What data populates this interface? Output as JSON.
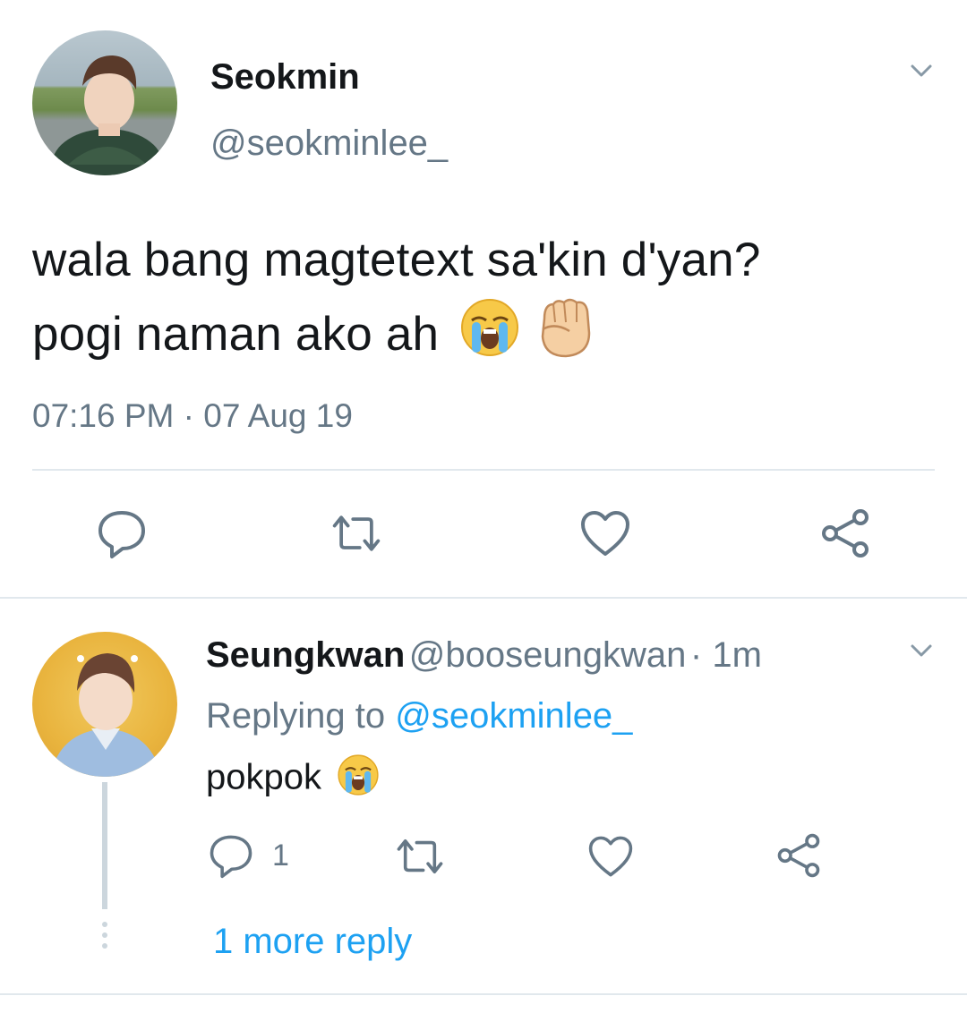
{
  "tweet": {
    "display_name": "Seokmin",
    "handle": "@seokminlee_",
    "text_line1": "wala bang magtetext sa'kin d'yan?",
    "text_line2": "pogi naman ako ah",
    "timestamp": "07:16 PM · 07 Aug 19",
    "emojis": [
      "loudly-crying-face",
      "raised-fist"
    ]
  },
  "reply": {
    "display_name": "Seungkwan",
    "handle": "@booseungkwan",
    "time": "· 1m",
    "replying_prefix": "Replying to",
    "replying_to": "@seokminlee_",
    "text": "pokpok",
    "emoji": "loudly-crying-face",
    "reply_count": "1",
    "more_replies": "1 more reply"
  },
  "colors": {
    "accent": "#1da1f2",
    "secondary_text": "#657786",
    "icon": "#657786",
    "divider": "#e1e8ed"
  }
}
